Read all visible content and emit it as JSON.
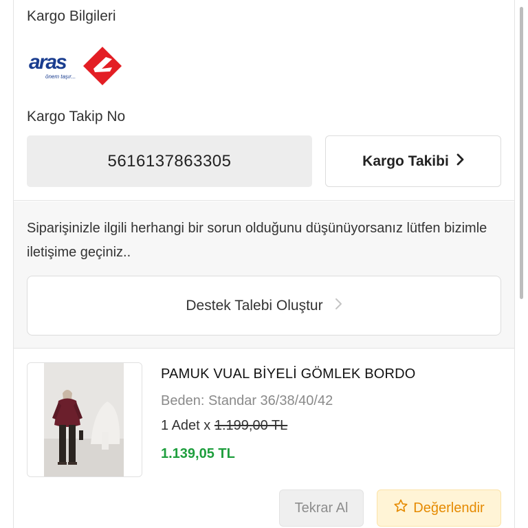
{
  "cargo": {
    "title": "Kargo Bilgileri",
    "carrier_logo": {
      "text": "aras",
      "tagline": "önem taşır...",
      "brand_color": "#e31e24",
      "text_color": "#1a3d8f"
    },
    "tracking_label": "Kargo Takip No",
    "tracking_number": "5616137863305",
    "track_button_label": "Kargo Takibi"
  },
  "support": {
    "message": "Siparişinizle ilgili herhangi bir sorun olduğunu düşünüyorsanız lütfen bizimle iletişime geçiniz..",
    "button_label": "Destek Talebi Oluştur"
  },
  "product": {
    "name": "PAMUK VUAL BİYELİ GÖMLEK BORDO",
    "size": "Beden: Standar 36/38/40/42",
    "quantity": "1 Adet",
    "multiplier": "x",
    "old_price": "1.199,00 TL",
    "price": "1.139,05 TL",
    "price_color": "#1e9e3d"
  },
  "actions": {
    "reorder_label": "Tekrar Al",
    "rate_label": "Değerlendir",
    "rate_color": "#e58a00"
  }
}
